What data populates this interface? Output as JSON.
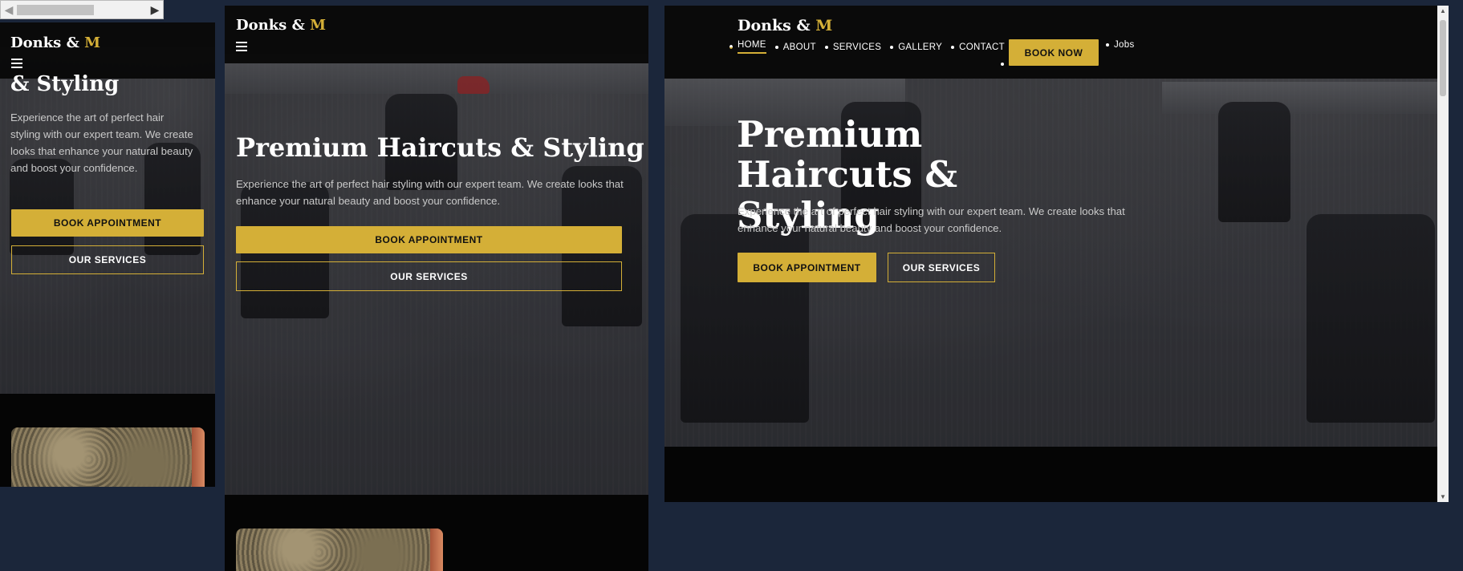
{
  "brand": {
    "name": "Donks",
    "amp": "&",
    "initial": "M",
    "accent": "#d4af37"
  },
  "hero": {
    "title": "Premium Haircuts & Styling",
    "mobile_visible_title": "& Styling",
    "subtitle": "Experience the art of perfect hair styling with our expert team. We create looks that enhance your natural beauty and boost your confidence.",
    "primary_cta": "BOOK APPOINTMENT",
    "secondary_cta": "OUR SERVICES"
  },
  "nav": {
    "items": [
      "HOME",
      "ABOUT",
      "SERVICES",
      "GALLERY",
      "CONTACT"
    ],
    "active": "HOME",
    "book_now": "BOOK NOW",
    "extra": "Jobs"
  },
  "icons": {
    "menu": "hamburger-icon",
    "scroll_left": "arrow-left-icon",
    "scroll_right": "arrow-right-icon"
  },
  "colors": {
    "background": "#1b263a",
    "header": "#080808",
    "gold": "#d4af37"
  }
}
